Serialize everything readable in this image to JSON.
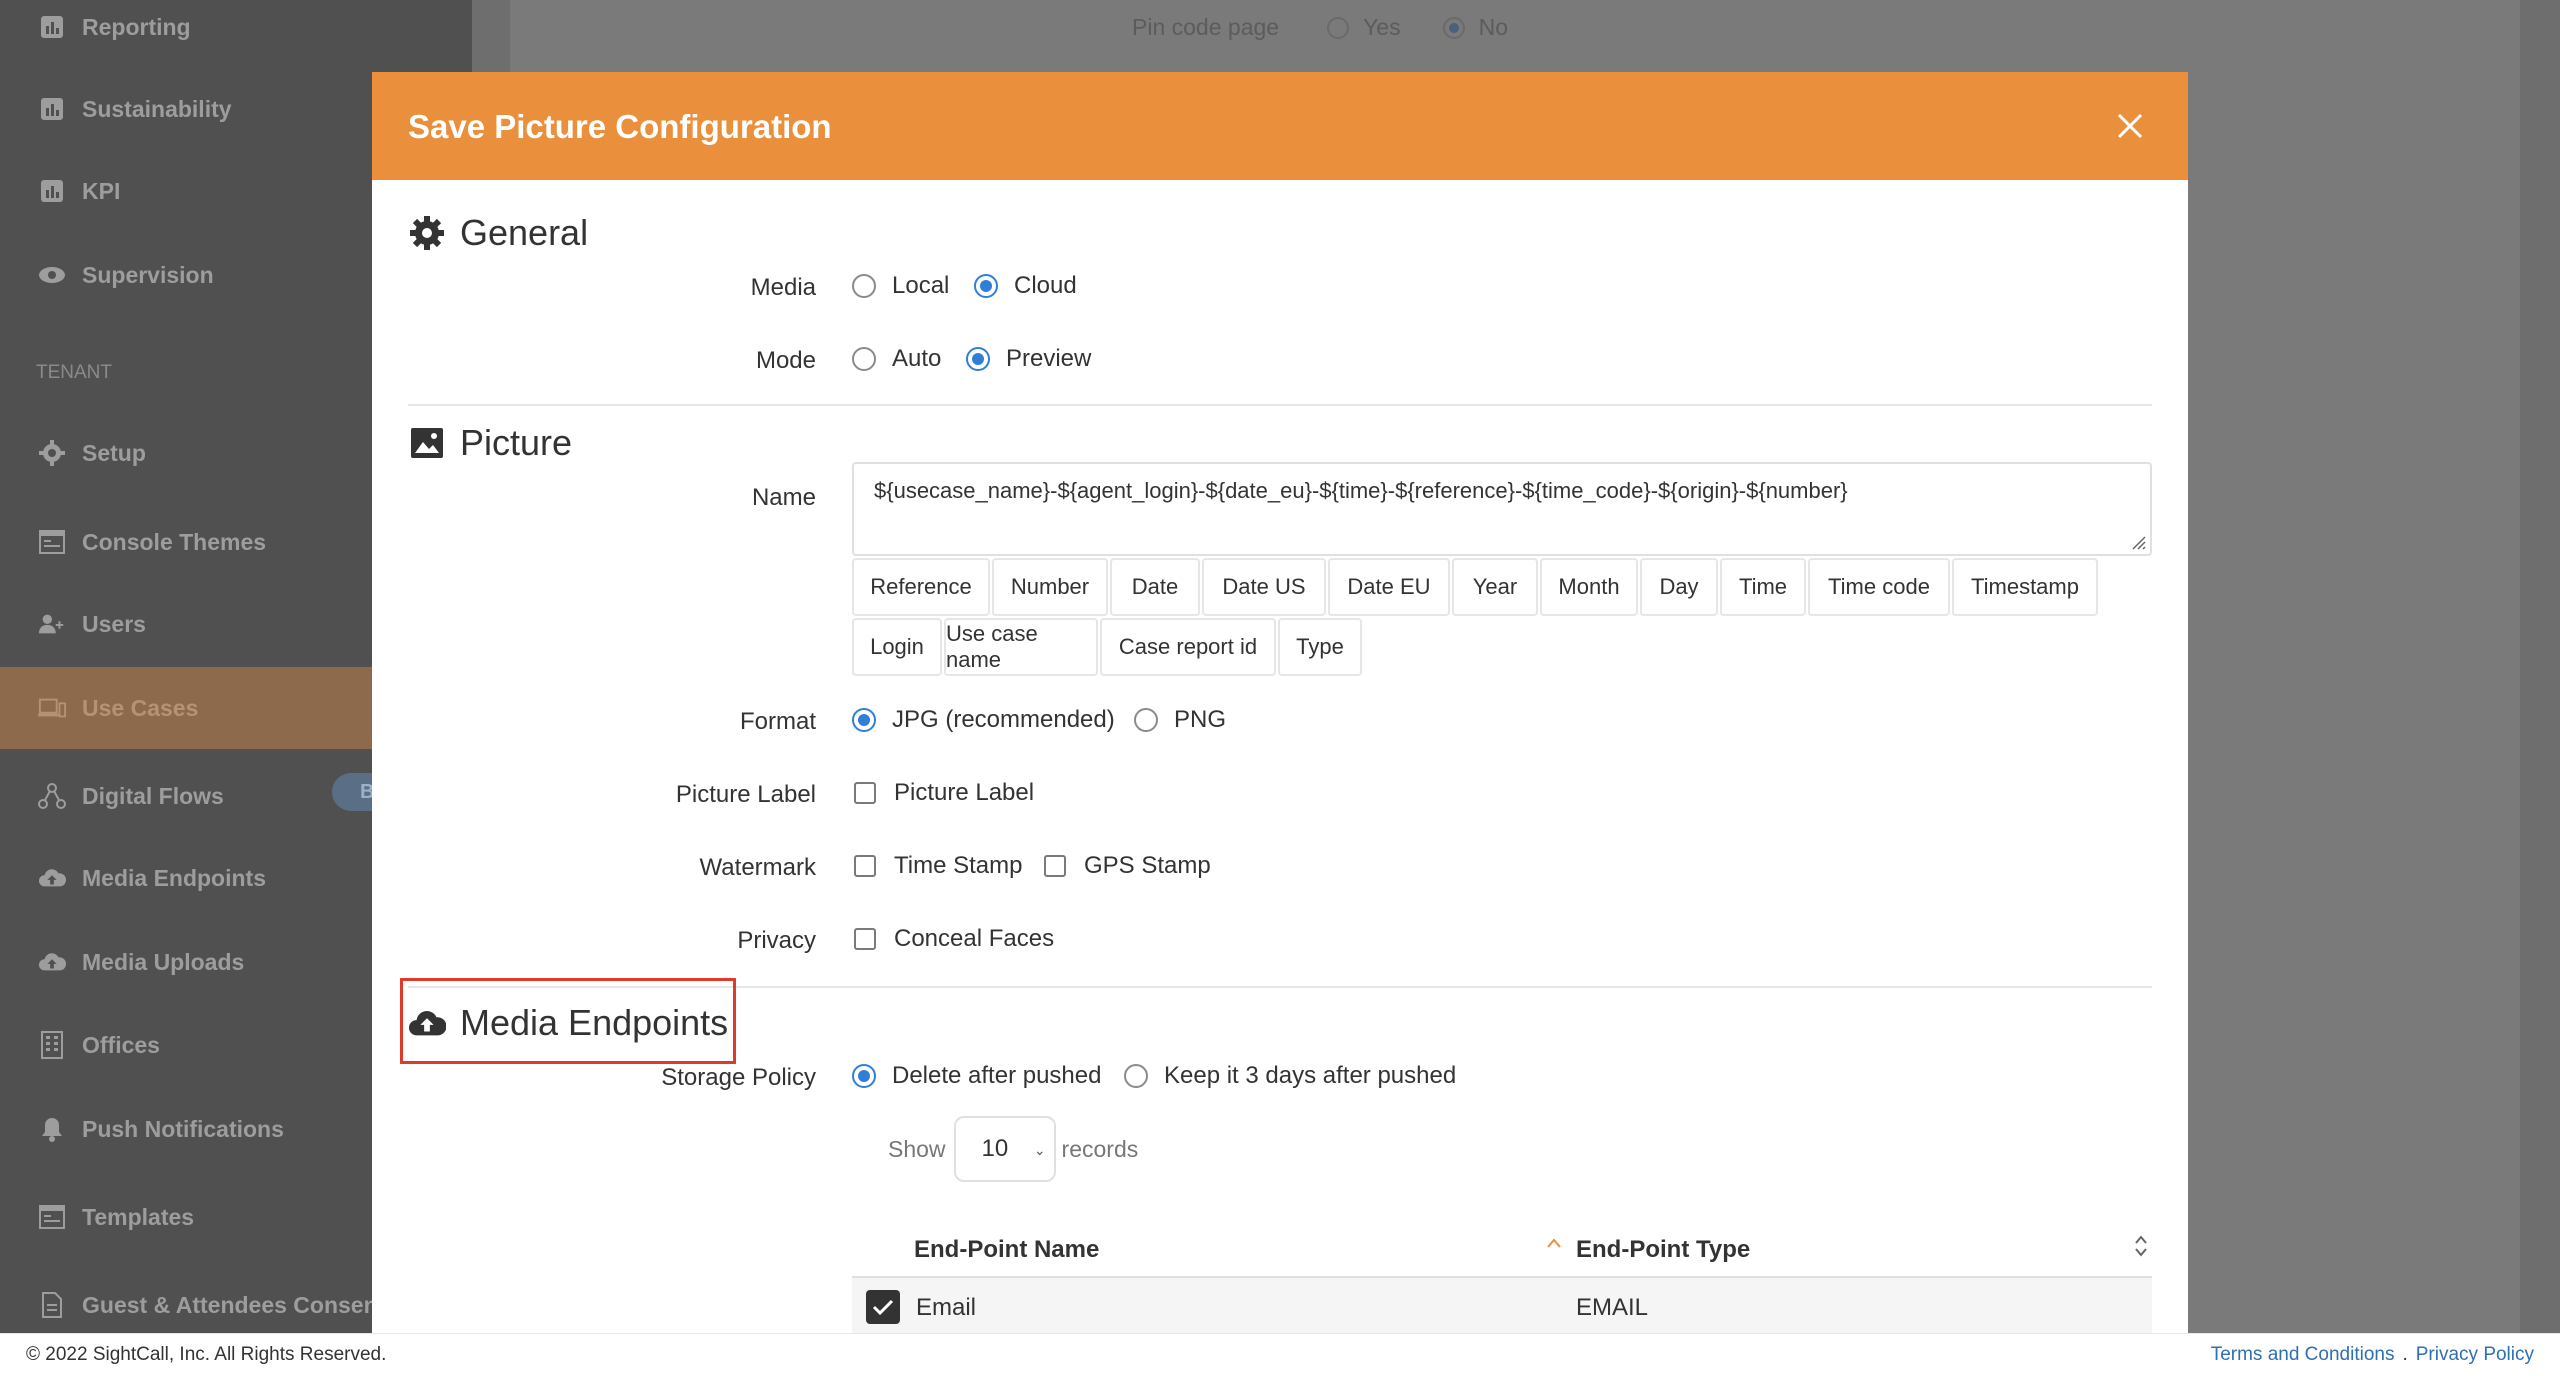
{
  "background": {
    "pin_code_label": "Pin code page",
    "pin_options": [
      {
        "label": "Yes",
        "selected": false
      },
      {
        "label": "No",
        "selected": true
      }
    ]
  },
  "sidebar": {
    "items_top": [
      {
        "label": "Reporting",
        "icon": "chart-icon"
      },
      {
        "label": "Sustainability",
        "icon": "chart-icon"
      },
      {
        "label": "KPI",
        "icon": "chart-icon"
      },
      {
        "label": "Supervision",
        "icon": "eye-icon"
      }
    ],
    "section_label": "TENANT",
    "items": [
      {
        "label": "Setup",
        "icon": "gear-icon"
      },
      {
        "label": "Console Themes",
        "icon": "theme-icon"
      },
      {
        "label": "Users",
        "icon": "users-icon"
      },
      {
        "label": "Use Cases",
        "icon": "devices-icon",
        "active": true
      },
      {
        "label": "Digital Flows",
        "icon": "flow-icon"
      },
      {
        "label": "Media Endpoints",
        "icon": "cloud-upload-icon"
      },
      {
        "label": "Media Uploads",
        "icon": "cloud-upload-icon"
      },
      {
        "label": "Offices",
        "icon": "building-icon"
      },
      {
        "label": "Push Notifications",
        "icon": "bell-icon"
      },
      {
        "label": "Templates",
        "icon": "theme-icon"
      },
      {
        "label": "Guest & Attendees Consent",
        "icon": "document-icon"
      }
    ],
    "badge": "B"
  },
  "modal": {
    "title": "Save Picture Configuration",
    "close_icon": "close-icon",
    "general": {
      "heading": "General",
      "media_label": "Media",
      "media_options": [
        {
          "label": "Local",
          "selected": false
        },
        {
          "label": "Cloud",
          "selected": true
        }
      ],
      "mode_label": "Mode",
      "mode_options": [
        {
          "label": "Auto",
          "selected": false
        },
        {
          "label": "Preview",
          "selected": true
        }
      ]
    },
    "picture": {
      "heading": "Picture",
      "name_label": "Name",
      "name_value": "${usecase_name}-${agent_login}-${date_eu}-${time}-${reference}-${time_code}-${origin}-${number}",
      "tags_row1": [
        "Reference",
        "Number",
        "Date",
        "Date US",
        "Date EU",
        "Year",
        "Month",
        "Day",
        "Time",
        "Time code",
        "Timestamp"
      ],
      "tags_row2": [
        "Login",
        "Use case name",
        "Case report id",
        "Type"
      ],
      "format_label": "Format",
      "format_options": [
        {
          "label": "JPG (recommended)",
          "selected": true
        },
        {
          "label": "PNG",
          "selected": false
        }
      ],
      "picture_label_label": "Picture Label",
      "picture_label_option": "Picture Label",
      "watermark_label": "Watermark",
      "watermark_options": [
        "Time Stamp",
        "GPS Stamp"
      ],
      "privacy_label": "Privacy",
      "privacy_option": "Conceal Faces"
    },
    "media_endpoints": {
      "heading": "Media Endpoints",
      "storage_policy_label": "Storage Policy",
      "storage_options": [
        {
          "label": "Delete after pushed",
          "selected": true
        },
        {
          "label": "Keep it 3 days after pushed",
          "selected": false
        }
      ],
      "show_label": "Show",
      "page_size": "10",
      "records_label": "records",
      "columns": [
        "End-Point Name",
        "End-Point Type"
      ],
      "rows": [
        {
          "name": "Email",
          "type": "EMAIL",
          "checked": true
        }
      ]
    }
  },
  "footer": {
    "copyright": "© 2022 SightCall, Inc. All Rights Reserved.",
    "terms": "Terms and Conditions",
    "separator": ".",
    "privacy": "Privacy Policy"
  }
}
